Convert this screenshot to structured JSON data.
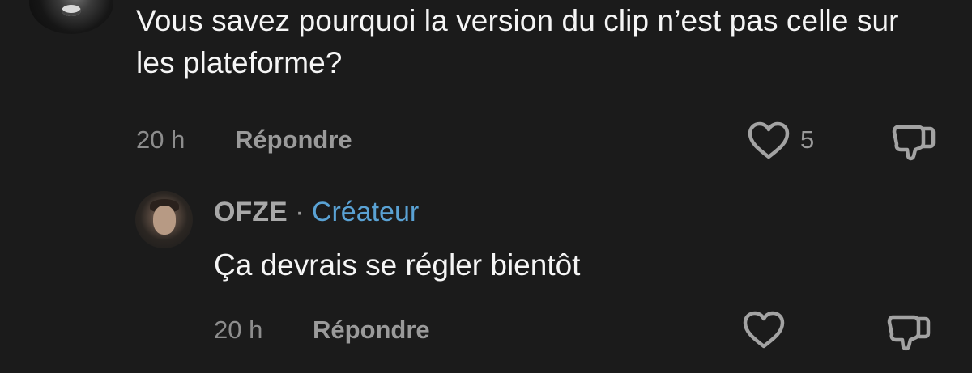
{
  "comment": {
    "text": "Vous savez pourquoi la version du clip n’est pas celle sur les plateforme?",
    "time": "20 h",
    "reply_label": "Répondre",
    "like_count": "5"
  },
  "reply": {
    "author": "OFZE",
    "separator": "·",
    "badge": "Créateur",
    "text": "Ça devrais se régler bientôt",
    "time": "20 h",
    "reply_label": "Répondre"
  },
  "colors": {
    "background": "#1b1b1b",
    "text": "#f5f5f5",
    "muted": "#9a9a9a",
    "creator_badge": "#5aa2d4"
  },
  "icons": {
    "like": "heart-outline-icon",
    "dislike": "thumbs-down-outline-icon"
  }
}
